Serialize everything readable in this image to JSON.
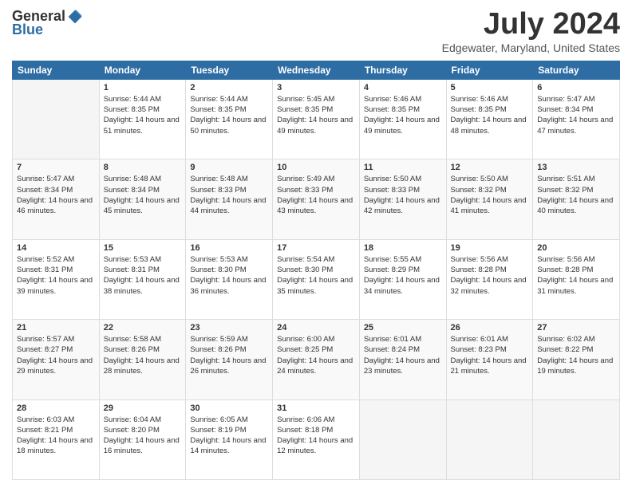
{
  "logo": {
    "general": "General",
    "blue": "Blue"
  },
  "header": {
    "title": "July 2024",
    "subtitle": "Edgewater, Maryland, United States"
  },
  "days_of_week": [
    "Sunday",
    "Monday",
    "Tuesday",
    "Wednesday",
    "Thursday",
    "Friday",
    "Saturday"
  ],
  "weeks": [
    [
      {
        "day": "",
        "sunrise": "",
        "sunset": "",
        "daylight": ""
      },
      {
        "day": "1",
        "sunrise": "Sunrise: 5:44 AM",
        "sunset": "Sunset: 8:35 PM",
        "daylight": "Daylight: 14 hours and 51 minutes."
      },
      {
        "day": "2",
        "sunrise": "Sunrise: 5:44 AM",
        "sunset": "Sunset: 8:35 PM",
        "daylight": "Daylight: 14 hours and 50 minutes."
      },
      {
        "day": "3",
        "sunrise": "Sunrise: 5:45 AM",
        "sunset": "Sunset: 8:35 PM",
        "daylight": "Daylight: 14 hours and 49 minutes."
      },
      {
        "day": "4",
        "sunrise": "Sunrise: 5:46 AM",
        "sunset": "Sunset: 8:35 PM",
        "daylight": "Daylight: 14 hours and 49 minutes."
      },
      {
        "day": "5",
        "sunrise": "Sunrise: 5:46 AM",
        "sunset": "Sunset: 8:35 PM",
        "daylight": "Daylight: 14 hours and 48 minutes."
      },
      {
        "day": "6",
        "sunrise": "Sunrise: 5:47 AM",
        "sunset": "Sunset: 8:34 PM",
        "daylight": "Daylight: 14 hours and 47 minutes."
      }
    ],
    [
      {
        "day": "7",
        "sunrise": "Sunrise: 5:47 AM",
        "sunset": "Sunset: 8:34 PM",
        "daylight": "Daylight: 14 hours and 46 minutes."
      },
      {
        "day": "8",
        "sunrise": "Sunrise: 5:48 AM",
        "sunset": "Sunset: 8:34 PM",
        "daylight": "Daylight: 14 hours and 45 minutes."
      },
      {
        "day": "9",
        "sunrise": "Sunrise: 5:48 AM",
        "sunset": "Sunset: 8:33 PM",
        "daylight": "Daylight: 14 hours and 44 minutes."
      },
      {
        "day": "10",
        "sunrise": "Sunrise: 5:49 AM",
        "sunset": "Sunset: 8:33 PM",
        "daylight": "Daylight: 14 hours and 43 minutes."
      },
      {
        "day": "11",
        "sunrise": "Sunrise: 5:50 AM",
        "sunset": "Sunset: 8:33 PM",
        "daylight": "Daylight: 14 hours and 42 minutes."
      },
      {
        "day": "12",
        "sunrise": "Sunrise: 5:50 AM",
        "sunset": "Sunset: 8:32 PM",
        "daylight": "Daylight: 14 hours and 41 minutes."
      },
      {
        "day": "13",
        "sunrise": "Sunrise: 5:51 AM",
        "sunset": "Sunset: 8:32 PM",
        "daylight": "Daylight: 14 hours and 40 minutes."
      }
    ],
    [
      {
        "day": "14",
        "sunrise": "Sunrise: 5:52 AM",
        "sunset": "Sunset: 8:31 PM",
        "daylight": "Daylight: 14 hours and 39 minutes."
      },
      {
        "day": "15",
        "sunrise": "Sunrise: 5:53 AM",
        "sunset": "Sunset: 8:31 PM",
        "daylight": "Daylight: 14 hours and 38 minutes."
      },
      {
        "day": "16",
        "sunrise": "Sunrise: 5:53 AM",
        "sunset": "Sunset: 8:30 PM",
        "daylight": "Daylight: 14 hours and 36 minutes."
      },
      {
        "day": "17",
        "sunrise": "Sunrise: 5:54 AM",
        "sunset": "Sunset: 8:30 PM",
        "daylight": "Daylight: 14 hours and 35 minutes."
      },
      {
        "day": "18",
        "sunrise": "Sunrise: 5:55 AM",
        "sunset": "Sunset: 8:29 PM",
        "daylight": "Daylight: 14 hours and 34 minutes."
      },
      {
        "day": "19",
        "sunrise": "Sunrise: 5:56 AM",
        "sunset": "Sunset: 8:28 PM",
        "daylight": "Daylight: 14 hours and 32 minutes."
      },
      {
        "day": "20",
        "sunrise": "Sunrise: 5:56 AM",
        "sunset": "Sunset: 8:28 PM",
        "daylight": "Daylight: 14 hours and 31 minutes."
      }
    ],
    [
      {
        "day": "21",
        "sunrise": "Sunrise: 5:57 AM",
        "sunset": "Sunset: 8:27 PM",
        "daylight": "Daylight: 14 hours and 29 minutes."
      },
      {
        "day": "22",
        "sunrise": "Sunrise: 5:58 AM",
        "sunset": "Sunset: 8:26 PM",
        "daylight": "Daylight: 14 hours and 28 minutes."
      },
      {
        "day": "23",
        "sunrise": "Sunrise: 5:59 AM",
        "sunset": "Sunset: 8:26 PM",
        "daylight": "Daylight: 14 hours and 26 minutes."
      },
      {
        "day": "24",
        "sunrise": "Sunrise: 6:00 AM",
        "sunset": "Sunset: 8:25 PM",
        "daylight": "Daylight: 14 hours and 24 minutes."
      },
      {
        "day": "25",
        "sunrise": "Sunrise: 6:01 AM",
        "sunset": "Sunset: 8:24 PM",
        "daylight": "Daylight: 14 hours and 23 minutes."
      },
      {
        "day": "26",
        "sunrise": "Sunrise: 6:01 AM",
        "sunset": "Sunset: 8:23 PM",
        "daylight": "Daylight: 14 hours and 21 minutes."
      },
      {
        "day": "27",
        "sunrise": "Sunrise: 6:02 AM",
        "sunset": "Sunset: 8:22 PM",
        "daylight": "Daylight: 14 hours and 19 minutes."
      }
    ],
    [
      {
        "day": "28",
        "sunrise": "Sunrise: 6:03 AM",
        "sunset": "Sunset: 8:21 PM",
        "daylight": "Daylight: 14 hours and 18 minutes."
      },
      {
        "day": "29",
        "sunrise": "Sunrise: 6:04 AM",
        "sunset": "Sunset: 8:20 PM",
        "daylight": "Daylight: 14 hours and 16 minutes."
      },
      {
        "day": "30",
        "sunrise": "Sunrise: 6:05 AM",
        "sunset": "Sunset: 8:19 PM",
        "daylight": "Daylight: 14 hours and 14 minutes."
      },
      {
        "day": "31",
        "sunrise": "Sunrise: 6:06 AM",
        "sunset": "Sunset: 8:18 PM",
        "daylight": "Daylight: 14 hours and 12 minutes."
      },
      {
        "day": "",
        "sunrise": "",
        "sunset": "",
        "daylight": ""
      },
      {
        "day": "",
        "sunrise": "",
        "sunset": "",
        "daylight": ""
      },
      {
        "day": "",
        "sunrise": "",
        "sunset": "",
        "daylight": ""
      }
    ]
  ]
}
